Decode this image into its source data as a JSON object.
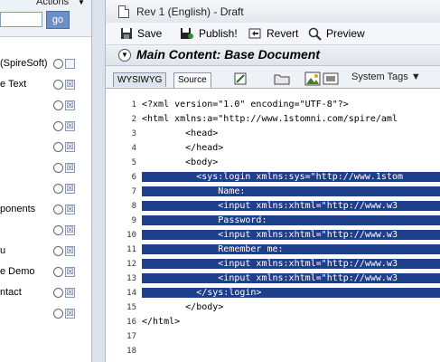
{
  "left_panel": {
    "actions_label": "Actions",
    "search_value": "",
    "go_label": "go",
    "rows": [
      {
        "label": "(SpireSoft)",
        "check": ""
      },
      {
        "label": "e Text",
        "check": "☒"
      },
      {
        "label": "",
        "check": "☒"
      },
      {
        "label": "",
        "check": "☒"
      },
      {
        "label": "",
        "check": "☒"
      },
      {
        "label": "",
        "check": "☒"
      },
      {
        "label": "",
        "check": "☒"
      },
      {
        "label": "ponents",
        "check": "☒"
      },
      {
        "label": "",
        "check": "☒"
      },
      {
        "label": "u",
        "check": "☒"
      },
      {
        "label": "e Demo",
        "check": "☒"
      },
      {
        "label": "ntact",
        "check": "☒"
      },
      {
        "label": "",
        "check": "☒"
      }
    ]
  },
  "window": {
    "title": "Rev 1 (English) - Draft"
  },
  "toolbar": {
    "save_label": "Save",
    "publish_label": "Publish!",
    "revert_label": "Revert",
    "preview_label": "Preview"
  },
  "content": {
    "title": "Main Content: Base Document"
  },
  "tabs": {
    "wysiwyg": "WYSIWYG",
    "source": "Source",
    "system_tags": "System Tags"
  },
  "editor": {
    "line_numbers": [
      "1",
      "2",
      "3",
      "4",
      "5",
      "6",
      "7",
      "8",
      "9",
      "10",
      "11",
      "12",
      "13",
      "14",
      "15",
      "16",
      "17",
      "18"
    ],
    "lines": [
      "<?xml version=\"1.0\" encoding=\"UTF-8\"?>",
      "<html xmlns:a=\"http://www.1stomni.com/spire/aml",
      "        <head>",
      "        </head>",
      "        <body>",
      "          <sys:login xmlns:sys=\"http://www.1stom",
      "              Name:",
      "              <input xmlns:xhtml=\"http://www.w3",
      "              Password:",
      "              <input xmlns:xhtml=\"http://www.w3",
      "              Remember me:",
      "              <input xmlns:xhtml=\"http://www.w3",
      "              <input xmlns:xhtml=\"http://www.w3",
      "          </sys:login>",
      "        </body>",
      "</html>",
      "",
      ""
    ]
  },
  "colors": {
    "selection": "#1e3f8a",
    "go_button": "#6e8fc4"
  }
}
